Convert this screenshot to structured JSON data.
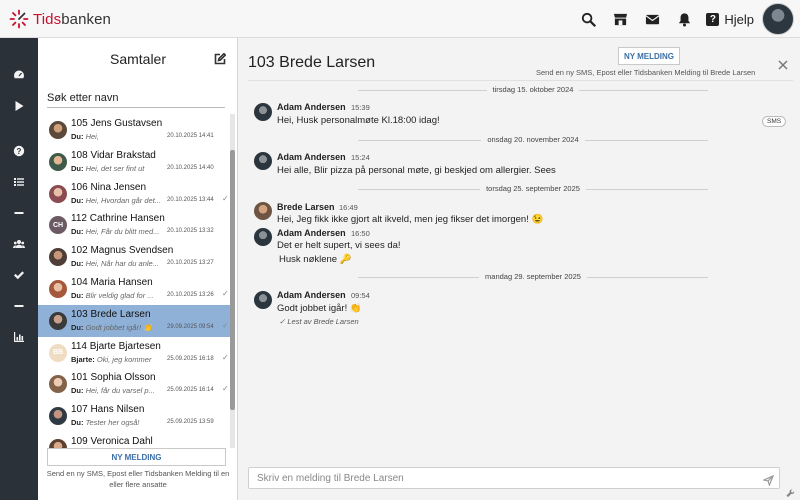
{
  "app": {
    "logo_text_1": "Tids",
    "logo_text_2": "banken",
    "help_label": "Hjelp",
    "brand_color": "#c8102e",
    "rail_color": "#2a3138",
    "accent_blue": "#3b6fa6"
  },
  "topbar_icons": [
    "search-icon",
    "store-icon",
    "mail-icon",
    "bell-icon",
    "help-icon"
  ],
  "rail_icons": [
    "dashboard-icon",
    "play-icon",
    "question-icon",
    "list-icon",
    "minus-icon",
    "users-icon",
    "check-icon",
    "minus-icon",
    "bar-chart-icon"
  ],
  "conversations": {
    "title": "Samtaler",
    "search_placeholder": "Søk etter navn",
    "items": [
      {
        "name": "105 Jens Gustavsen",
        "from": "Du:",
        "snippet": "Hei,",
        "date": "20.10.2025 14:41",
        "check": "",
        "avatar": "p1",
        "initials": ""
      },
      {
        "name": "108 Vidar Brakstad",
        "from": "Du:",
        "snippet": "Hei, det ser fint ut",
        "date": "20.10.2025 14:40",
        "check": "",
        "avatar": "p2",
        "initials": ""
      },
      {
        "name": "106 Nina Jensen",
        "from": "Du:",
        "snippet": "Hei, Hvordan går det...",
        "date": "20.10.2025 13:44",
        "check": "✓",
        "avatar": "p3",
        "initials": ""
      },
      {
        "name": "112 Cathrine Hansen",
        "from": "Du:",
        "snippet": "Hei, Får du blitt med...",
        "date": "20.10.2025 13:32",
        "check": "",
        "avatar": "ini-dark",
        "initials": "CH"
      },
      {
        "name": "102 Magnus Svendsen",
        "from": "Du:",
        "snippet": "Hei, Når har du anle...",
        "date": "20.10.2025 13:27",
        "check": "",
        "avatar": "p4",
        "initials": ""
      },
      {
        "name": "104 Maria Hansen",
        "from": "Du:",
        "snippet": "Blir veldig glad for ...",
        "date": "20.10.2025 13:26",
        "check": "✓",
        "avatar": "p5",
        "initials": ""
      },
      {
        "name": "103 Brede Larsen",
        "from": "Du:",
        "snippet": "Godt jobbet igår! 👏",
        "date": "29.09.2025 09:54",
        "check": "✓",
        "avatar": "p6",
        "initials": ""
      },
      {
        "name": "114 Bjarte Bjartesen",
        "from": "Bjarte:",
        "snippet": "Oki, jeg kommer",
        "date": "25.09.2025 16:18",
        "check": "✓",
        "avatar": "ini-light",
        "initials": "BB"
      },
      {
        "name": "101 Sophia Olsson",
        "from": "Du:",
        "snippet": "Hei, får du varsel p...",
        "date": "25.09.2025 16:14",
        "check": "✓",
        "avatar": "p7",
        "initials": ""
      },
      {
        "name": "107 Hans Nilsen",
        "from": "Du:",
        "snippet": "Tester her også!",
        "date": "25.09.2025 13:59",
        "check": "",
        "avatar": "p8",
        "initials": ""
      },
      {
        "name": "109 Veronica Dahl",
        "from": "",
        "snippet": "",
        "date": "",
        "check": "",
        "avatar": "p9",
        "initials": ""
      }
    ],
    "selected_index": 6,
    "new_message_label": "NY MELDING",
    "new_message_hint": "Send en ny SMS, Epost eller Tidsbanken Melding til en eller flere ansatte"
  },
  "chat": {
    "title": "103 Brede Larsen",
    "new_message_label": "NY MELDING",
    "new_message_hint": "Send en ny SMS, Epost eller Tidsbanken Melding til Brede Larsen",
    "date_1": "tirsdag 15. oktober 2024",
    "date_2": "onsdag 20. november 2024",
    "date_3": "torsdag 25. september 2025",
    "date_4": "mandag 29. september 2025",
    "messages": [
      {
        "author": "Adam Andersen",
        "time": "15:39",
        "text": "Hei, Husk personalmøte Kl.18:00 idag!",
        "badge": "SMS"
      },
      {
        "author": "Adam Andersen",
        "time": "15:24",
        "text": "Hei alle, Blir pizza på personal møte, gi beskjed om allergier. Sees"
      },
      {
        "author": "Brede Larsen",
        "time": "16:49",
        "text": "Hei, Jeg fikk ikke gjort alt ikveld, men jeg fikser det imorgen! 😉"
      },
      {
        "author": "Adam Andersen",
        "time": "16:50",
        "text": "Det er helt supert, vi sees da!",
        "text2": "Husk nøklene 🔑"
      },
      {
        "author": "Adam Andersen",
        "time": "09:54",
        "text": "Godt jobbet igår! 👏",
        "read": "✓ Lest av Brede Larsen"
      }
    ],
    "composer_placeholder": "Skriv en melding til Brede Larsen"
  }
}
